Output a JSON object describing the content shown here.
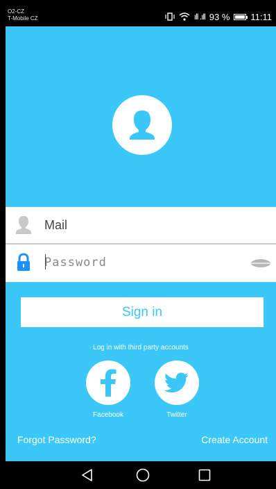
{
  "status_bar": {
    "carrier_primary": "O2-CZ",
    "carrier_secondary": "T-Mobile CZ",
    "signal_glyphs": "ıll  .ıll",
    "battery_text": "93 %",
    "time": "11:11"
  },
  "form": {
    "mail_placeholder": "Mail",
    "password_placeholder": "Password"
  },
  "actions": {
    "sign_in_label": "Sign in",
    "third_party_label": "Log in with third party accounts",
    "facebook_label": "Facebook",
    "twitter_label": "Twitter",
    "forgot_password_label": "Forgot Password?",
    "create_account_label": "Create Account"
  },
  "colors": {
    "accent": "#3cc7f9",
    "lock_icon": "#1e90ff",
    "user_icon": "#c8c8c8"
  },
  "icons": {
    "avatar": "person-icon",
    "mail_field": "user-icon",
    "password_field": "lock-icon",
    "password_toggle": "eye-icon",
    "facebook": "facebook-icon",
    "twitter": "twitter-icon",
    "nav": [
      "back-icon",
      "home-icon",
      "recents-icon"
    ]
  }
}
